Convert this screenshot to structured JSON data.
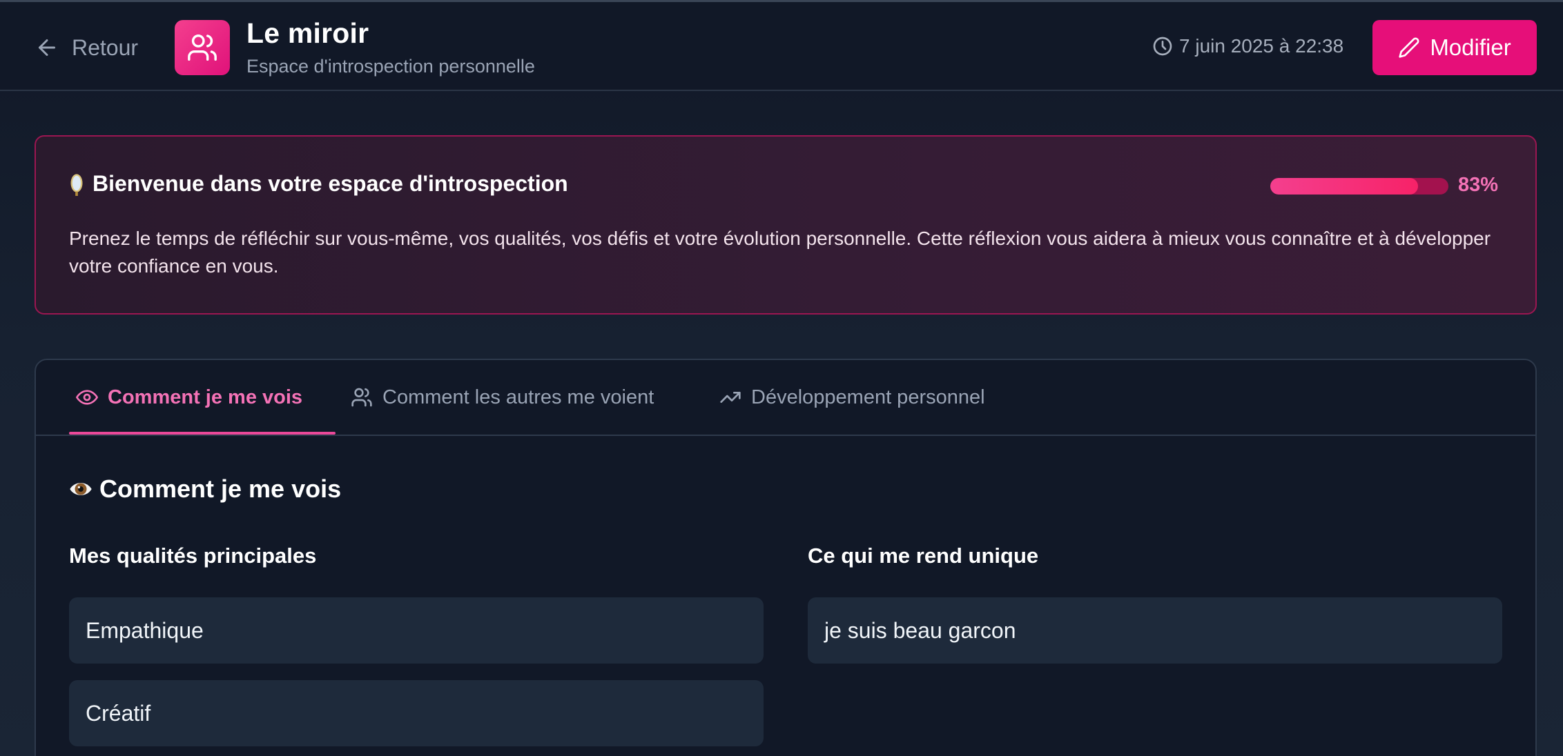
{
  "header": {
    "back_label": "Retour",
    "title": "Le miroir",
    "subtitle": "Espace d'introspection personnelle",
    "timestamp": "7 juin 2025 à 22:38",
    "edit_label": "Modifier"
  },
  "welcome": {
    "title": "Bienvenue dans votre espace d'introspection",
    "progress_percent": 83,
    "progress_label": "83%",
    "text": "Prenez le temps de réfléchir sur vous-même, vos qualités, vos défis et votre évolution personnelle. Cette réflexion vous aidera à mieux vous connaître et à développer votre confiance en vous."
  },
  "tabs": [
    {
      "label": "Comment je me vois",
      "icon": "eye-icon",
      "active": true
    },
    {
      "label": "Comment les autres me voient",
      "icon": "users-icon",
      "active": false
    },
    {
      "label": "Développement personnel",
      "icon": "trending-up-icon",
      "active": false
    }
  ],
  "section": {
    "title": "Comment je me vois",
    "qualities_label": "Mes qualités principales",
    "qualities": [
      "Empathique",
      "Créatif"
    ],
    "unique_label": "Ce qui me rend unique",
    "unique_values": [
      "je suis beau garcon"
    ]
  },
  "colors": {
    "accent": "#e60f79",
    "accent_text": "#f472b6",
    "background": "#111827",
    "field_background": "#1e2a3b"
  }
}
